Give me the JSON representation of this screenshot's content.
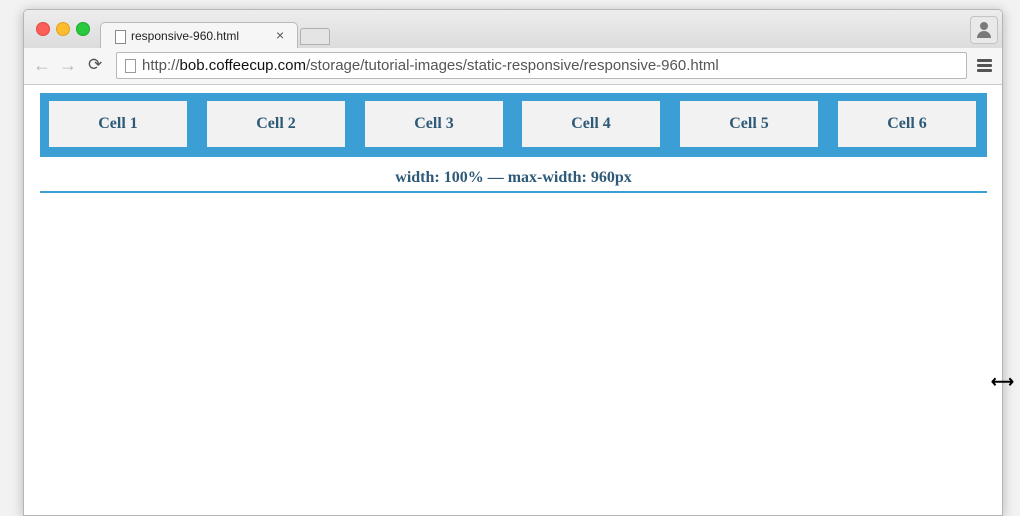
{
  "tab": {
    "title": "responsive-960.html",
    "close": "×"
  },
  "nav": {
    "back_icon": "←",
    "forward_icon": "→",
    "reload_icon": "⟳"
  },
  "address": {
    "scheme": "http://",
    "host": "bob.coffeecup.com",
    "path": "/storage/tutorial-images/static-responsive/responsive-960.html"
  },
  "page": {
    "cells": [
      "Cell 1",
      "Cell 2",
      "Cell 3",
      "Cell 4",
      "Cell 5",
      "Cell 6"
    ],
    "caption": "width: 100% — max-width: 960px"
  },
  "cursor": {
    "glyph": "⟷"
  },
  "colors": {
    "accent": "#3b9ed4",
    "cell_text": "#2e5a78",
    "cell_bg": "#f2f2f2"
  }
}
